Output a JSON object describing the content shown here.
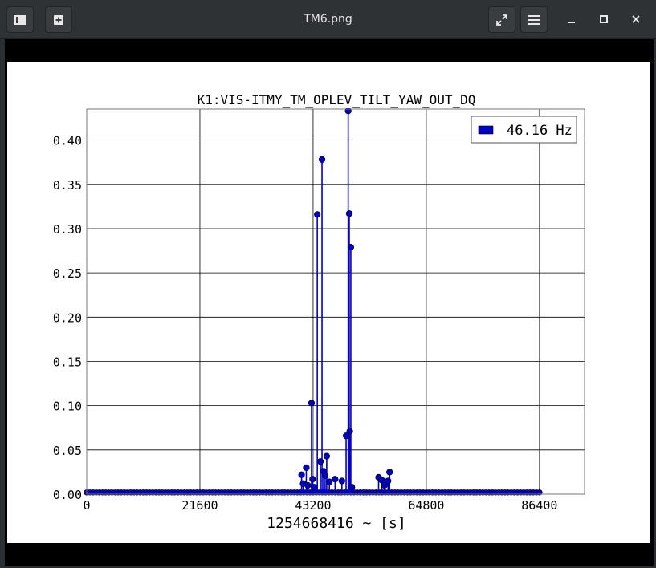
{
  "window": {
    "title": "TM6.png"
  },
  "toolbar": {
    "left_buttons": [
      {
        "name": "gallery-button",
        "icon": "gallery-icon"
      },
      {
        "name": "new-window-button",
        "icon": "plus-square-icon"
      }
    ],
    "right_buttons": [
      {
        "name": "fullscreen-button",
        "icon": "expand-icon"
      },
      {
        "name": "menu-button",
        "icon": "hamburger-icon"
      }
    ],
    "window_controls": [
      {
        "name": "minimize-button",
        "icon": "minimize-icon"
      },
      {
        "name": "maximize-button",
        "icon": "maximize-icon"
      },
      {
        "name": "close-button",
        "icon": "close-icon"
      }
    ]
  },
  "colors": {
    "series": "#0000cc",
    "marker": "#0000cc",
    "titlebar": "#2f3234"
  },
  "chart_data": {
    "type": "scatter",
    "title": "K1:VIS-ITMY_TM_OPLEV_TILT_YAW_OUT_DQ",
    "xlabel": "1254668416 ~ [s]",
    "ylabel": "",
    "xlim": [
      0,
      95000
    ],
    "ylim": [
      0,
      0.435
    ],
    "xticks": [
      0,
      21600,
      43200,
      64800,
      86400
    ],
    "xtick_labels": [
      "0",
      "21600",
      "43200",
      "64800",
      "86400"
    ],
    "yticks": [
      0.0,
      0.05,
      0.1,
      0.15,
      0.2,
      0.25,
      0.3,
      0.35,
      0.4
    ],
    "ytick_labels": [
      "0.00",
      "0.05",
      "0.10",
      "0.15",
      "0.20",
      "0.25",
      "0.30",
      "0.35",
      "0.40"
    ],
    "grid": true,
    "legend_position": "top-right",
    "series": [
      {
        "name": "46.16 Hz",
        "style": "stem",
        "x": [
          41000,
          41300,
          41900,
          42200,
          42900,
          43100,
          43400,
          44000,
          44600,
          44900,
          45200,
          45500,
          45800,
          46300,
          47400,
          48700,
          49500,
          49900,
          50100,
          50200,
          50400,
          50600,
          55700,
          56300,
          56800,
          57500,
          57800
        ],
        "y": [
          0.022,
          0.012,
          0.03,
          0.01,
          0.103,
          0.017,
          0.008,
          0.316,
          0.037,
          0.378,
          0.026,
          0.021,
          0.043,
          0.014,
          0.017,
          0.015,
          0.066,
          0.433,
          0.317,
          0.071,
          0.279,
          0.008,
          0.019,
          0.016,
          0.01,
          0.015,
          0.025
        ]
      }
    ],
    "baseline_samples": {
      "x_start": 0,
      "x_end": 86400,
      "step": 600,
      "y": 0.002
    }
  }
}
